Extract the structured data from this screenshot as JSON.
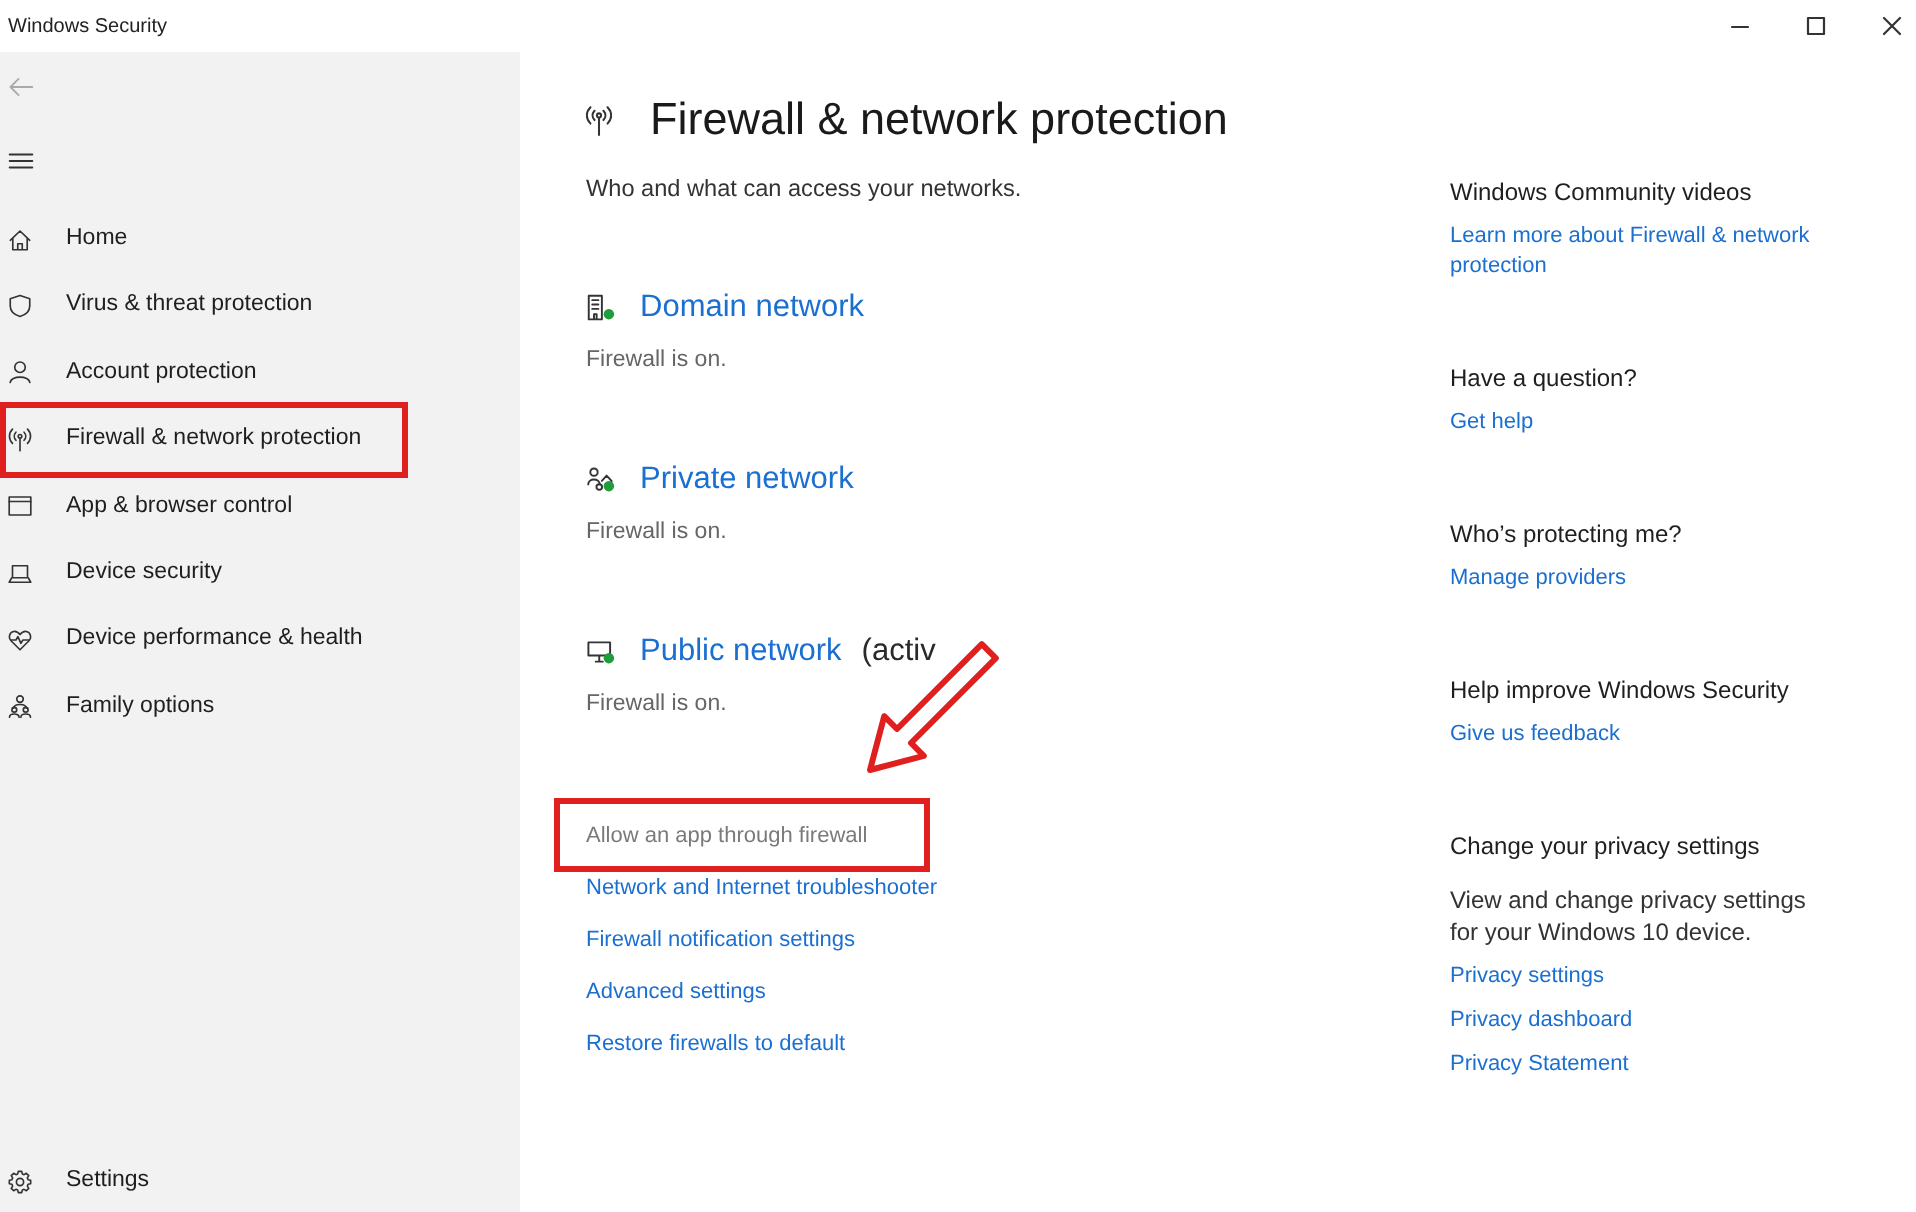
{
  "window": {
    "title": "Windows Security"
  },
  "sidebar": {
    "items": [
      {
        "label": "Home",
        "highlighted": false
      },
      {
        "label": "Virus & threat protection",
        "highlighted": false
      },
      {
        "label": "Account protection",
        "highlighted": false
      },
      {
        "label": "Firewall & network protection",
        "highlighted": true
      },
      {
        "label": "App & browser control",
        "highlighted": false
      },
      {
        "label": "Device security",
        "highlighted": false
      },
      {
        "label": "Device performance & health",
        "highlighted": false
      },
      {
        "label": "Family options",
        "highlighted": false
      }
    ],
    "footer": {
      "label": "Settings"
    }
  },
  "main": {
    "title": "Firewall & network protection",
    "subtitle": "Who and what can access your networks.",
    "networks": [
      {
        "name": "Domain network",
        "status": "Firewall is on."
      },
      {
        "name": "Private network",
        "status": "Firewall is on."
      },
      {
        "name": "Public network",
        "note": "(activ",
        "status": "Firewall is on."
      }
    ],
    "links": [
      {
        "label": "Allow an app through firewall",
        "disabled": true,
        "highlighted": true
      },
      {
        "label": "Network and Internet troubleshooter",
        "disabled": false,
        "highlighted": false
      },
      {
        "label": "Firewall notification settings",
        "disabled": false,
        "highlighted": false
      },
      {
        "label": "Advanced settings",
        "disabled": false,
        "highlighted": false
      },
      {
        "label": "Restore firewalls to default",
        "disabled": false,
        "highlighted": false
      }
    ]
  },
  "aside": {
    "sections": [
      {
        "heading": "Windows Community videos",
        "links": [
          "Learn more about Firewall & network protection"
        ]
      },
      {
        "heading": "Have a question?",
        "links": [
          "Get help"
        ]
      },
      {
        "heading": "Who’s protecting me?",
        "links": [
          "Manage providers"
        ]
      },
      {
        "heading": "Help improve Windows Security",
        "links": [
          "Give us feedback"
        ]
      },
      {
        "heading": "Change your privacy settings",
        "description": "View and change privacy settings for your Windows 10 device.",
        "links": [
          "Privacy settings",
          "Privacy dashboard",
          "Privacy Statement"
        ]
      }
    ]
  }
}
